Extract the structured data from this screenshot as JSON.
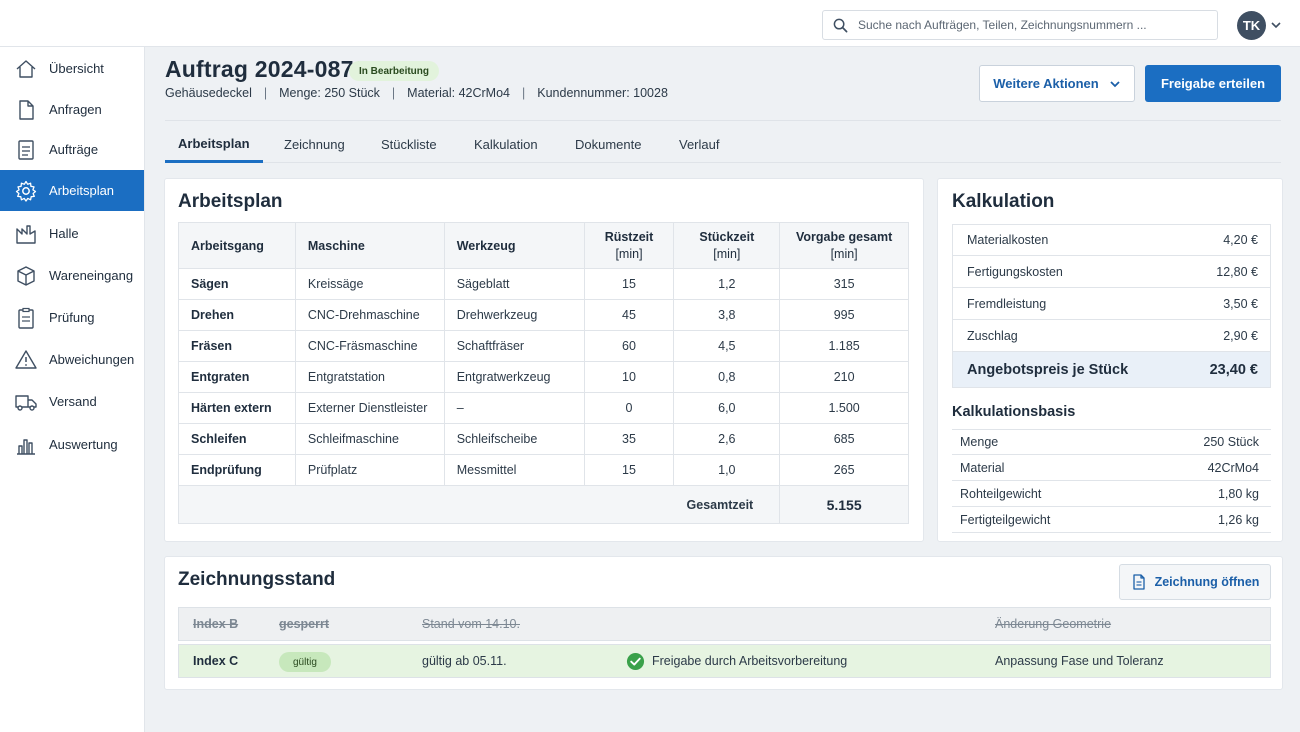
{
  "topbar": {
    "search_placeholder": "Suche nach Aufträgen, Teilen, Zeichnungsnummern ...",
    "avatar_initials": "TK"
  },
  "sidebar": {
    "items": [
      {
        "label": "Übersicht",
        "icon": "home-icon"
      },
      {
        "label": "Anfragen",
        "icon": "document-icon"
      },
      {
        "label": "Aufträge",
        "icon": "clipboard-list-icon"
      },
      {
        "label": "Arbeitsplan",
        "icon": "gear-icon",
        "active": true
      },
      {
        "label": "Halle",
        "icon": "factory-icon"
      },
      {
        "label": "Wareneingang",
        "icon": "box-icon"
      },
      {
        "label": "Prüfung",
        "icon": "clipboard-check-icon"
      },
      {
        "label": "Abweichungen",
        "icon": "warning-icon"
      },
      {
        "label": "Versand",
        "icon": "truck-icon"
      },
      {
        "label": "Auswertung",
        "icon": "bar-chart-icon"
      }
    ]
  },
  "header": {
    "title": "Auftrag 2024-0876",
    "status": "In Bearbeitung",
    "part": "Gehäusedeckel",
    "quantity_label": "Menge:",
    "quantity_value": "250 Stück",
    "material_label": "Material:",
    "material_value": "42CrMo4",
    "customer_label": "Kundennummer:",
    "customer_value": "10028",
    "more_actions": "Weitere Aktionen",
    "release": "Freigabe erteilen"
  },
  "tabs": [
    "Arbeitsplan",
    "Zeichnung",
    "Stückliste",
    "Kalkulation",
    "Dokumente",
    "Verlauf"
  ],
  "arbeitsplan": {
    "title": "Arbeitsplan",
    "columns": {
      "step": "Arbeitsgang",
      "machine": "Maschine",
      "tool": "Werkzeug",
      "setup": "Rüstzeit",
      "unit_time": "Stückzeit",
      "total": "Vorgabe gesamt",
      "unit": "[min]"
    },
    "rows": [
      {
        "step": "Sägen",
        "machine": "Kreissäge",
        "tool": "Sägeblatt",
        "setup": "15",
        "unit_time": "1,2",
        "total": "315"
      },
      {
        "step": "Drehen",
        "machine": "CNC-Drehmaschine",
        "tool": "Drehwerkzeug",
        "setup": "45",
        "unit_time": "3,8",
        "total": "995"
      },
      {
        "step": "Fräsen",
        "machine": "CNC-Fräsmaschine",
        "tool": "Schaftfräser",
        "setup": "60",
        "unit_time": "4,5",
        "total": "1.185"
      },
      {
        "step": "Entgraten",
        "machine": "Entgratstation",
        "tool": "Entgratwerkzeug",
        "setup": "10",
        "unit_time": "0,8",
        "total": "210"
      },
      {
        "step": "Härten extern",
        "machine": "Externer Dienstleister",
        "tool": "–",
        "setup": "0",
        "unit_time": "6,0",
        "total": "1.500"
      },
      {
        "step": "Schleifen",
        "machine": "Schleifmaschine",
        "tool": "Schleifscheibe",
        "setup": "35",
        "unit_time": "2,6",
        "total": "685"
      },
      {
        "step": "Endprüfung",
        "machine": "Prüfplatz",
        "tool": "Messmittel",
        "setup": "15",
        "unit_time": "1,0",
        "total": "265"
      }
    ],
    "total_label": "Gesamtzeit",
    "total_value": "5.155"
  },
  "kalkulation": {
    "title": "Kalkulation",
    "rows": [
      {
        "label": "Materialkosten",
        "value": "4,20 €"
      },
      {
        "label": "Fertigungskosten",
        "value": "12,80 €"
      },
      {
        "label": "Fremdleistung",
        "value": "3,50 €"
      },
      {
        "label": "Zuschlag",
        "value": "2,90 €"
      }
    ],
    "total_label": "Angebotspreis je Stück",
    "total_value": "23,40 €",
    "basis_title": "Kalkulationsbasis",
    "basis": [
      {
        "label": "Menge",
        "value": "250 Stück"
      },
      {
        "label": "Material",
        "value": "42CrMo4"
      },
      {
        "label": "Rohteilgewicht",
        "value": "1,80 kg"
      },
      {
        "label": "Fertigteilgewicht",
        "value": "1,26 kg"
      }
    ]
  },
  "zeichnung": {
    "title": "Zeichnungsstand",
    "open_button": "Zeichnung öffnen",
    "revisions": [
      {
        "index": "Index B",
        "status": "gesperrt",
        "date": "Stand vom 14.10.",
        "approval": "",
        "change": "Änderung Geometrie"
      },
      {
        "index": "Index C",
        "status": "gültig",
        "date": "gültig ab 05.11.",
        "approval": "Freigabe durch Arbeitsvorbereitung",
        "change": "Anpassung Fase und Toleranz"
      }
    ]
  },
  "colors": {
    "primary": "#1b6ec2",
    "status_green": "#e2f3dc",
    "check_green": "#3aa14a"
  }
}
